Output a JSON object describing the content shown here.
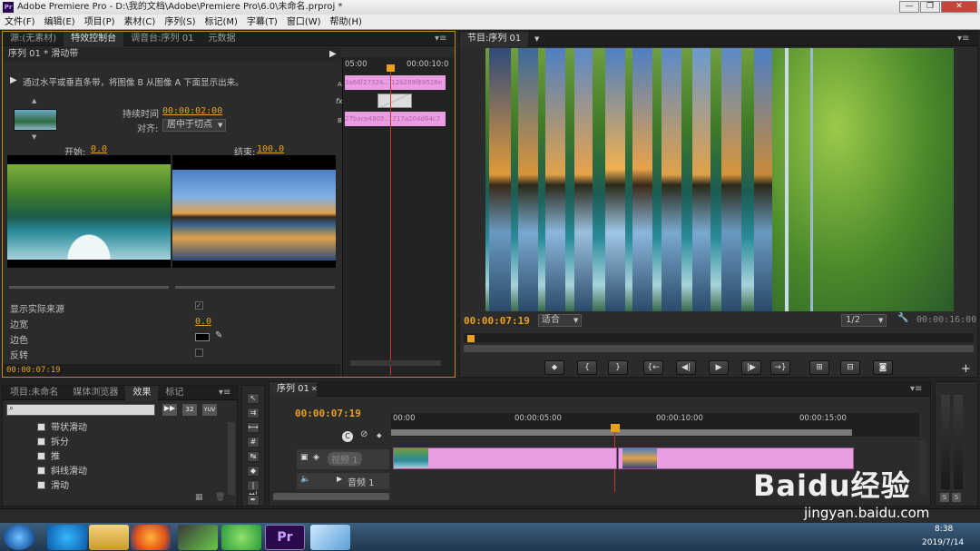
{
  "window": {
    "title": "Adobe Premiere Pro - D:\\我的文档\\Adobe\\Premiere Pro\\6.0\\未命名.prproj *"
  },
  "menu": [
    "文件(F)",
    "编辑(E)",
    "项目(P)",
    "素材(C)",
    "序列(S)",
    "标记(M)",
    "字幕(T)",
    "窗口(W)",
    "帮助(H)"
  ],
  "effect_controls": {
    "tabs": [
      "源:(无素材)",
      "特效控制台",
      "调音台:序列 01",
      "元数据"
    ],
    "header": "序列 01 * 滑动带",
    "description": "通过水平或垂直条带，将图像 B 从图像 A 下面显示出来。",
    "duration_label": "持续时间",
    "duration_value": "00:00:02:00",
    "align_label": "对齐:",
    "align_value": "居中于切点",
    "start_label": "开始:",
    "start_value": "0.0",
    "end_label": "结束:",
    "end_value": "100.0",
    "show_source_label": "显示实际来源",
    "border_width_label": "边宽",
    "border_width_value": "0.0",
    "border_color_label": "边色",
    "reverse_label": "反转",
    "timecode": "00:00:07:19",
    "mini_ruler_start": "05:00",
    "mini_ruler_end": "00:00:10:0",
    "clip_a_label": "3a66f27324...",
    "clip_a_label2": "12b289f69528e",
    "clip_b_label": "27bace4805...",
    "clip_b_label2": "217a204d64c7",
    "track_a": "A",
    "track_b": "B",
    "fx": "fx"
  },
  "program": {
    "tab": "节目:序列 01",
    "timecode": "00:00:07:19",
    "fit": "适合",
    "resolution": "1/2",
    "duration": "00:00:16:00"
  },
  "project": {
    "tabs": [
      "项目:未命名",
      "媒体浏览器",
      "效果",
      "标记"
    ],
    "effects": [
      "带状滑动",
      "拆分",
      "推",
      "斜线滑动",
      "滑动"
    ]
  },
  "timeline": {
    "tab": "序列 01",
    "timecode": "00:00:07:19",
    "ruler": [
      "00:00",
      "00:00:05:00",
      "00:00:10:00",
      "00:00:15:00"
    ],
    "video_track": "视频 1",
    "audio_track": "音频 1"
  },
  "taskbar": {
    "time": "8:38",
    "date": "2019/7/14"
  },
  "watermark": {
    "text": "Baidu经验",
    "url": "jingyan.baidu.com"
  },
  "colors": {
    "accent": "#e8a11c",
    "clip": "#e99ee3",
    "playhead": "#c0392b"
  }
}
